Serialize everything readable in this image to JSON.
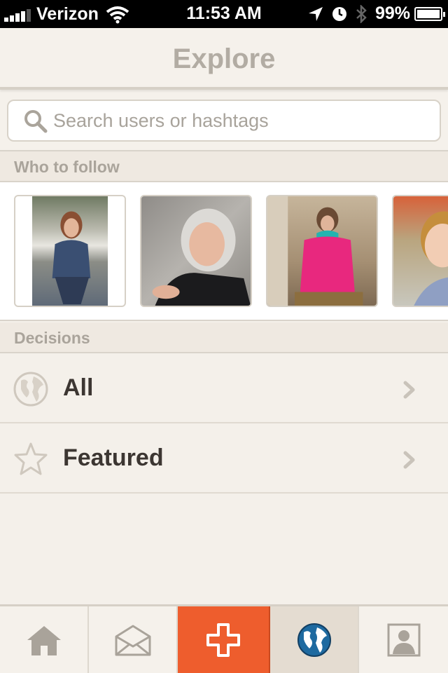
{
  "status_bar": {
    "carrier": "Verizon",
    "time": "11:53 AM",
    "battery": "99%",
    "battery_level": 0.99,
    "signal_bars": 4
  },
  "navbar": {
    "title": "Explore"
  },
  "search": {
    "placeholder": "Search users or hashtags",
    "value": ""
  },
  "who_to_follow": {
    "header": "Who to follow"
  },
  "decisions": {
    "header": "Decisions",
    "rows": [
      {
        "label": "All",
        "icon": "globe-icon"
      },
      {
        "label": "Featured",
        "icon": "star-icon"
      }
    ]
  },
  "tabbar": {
    "tabs": [
      {
        "icon": "home-icon"
      },
      {
        "icon": "envelope-icon"
      },
      {
        "icon": "plus-icon"
      },
      {
        "icon": "globe-icon",
        "active": true
      },
      {
        "icon": "profile-icon"
      }
    ]
  },
  "colors": {
    "accent": "#ee5d2d",
    "background": "#f4f0ea",
    "active_tab_globe": "#1e6aa0"
  }
}
